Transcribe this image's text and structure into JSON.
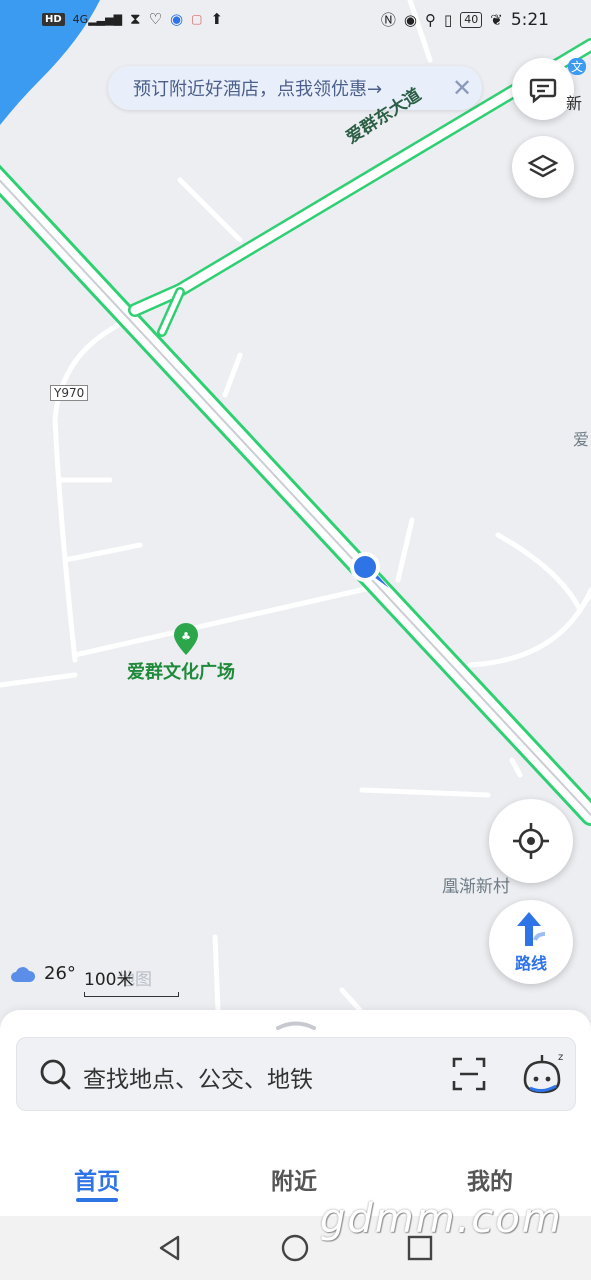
{
  "status_bar": {
    "network": "HD",
    "signal": "4G",
    "battery": "40",
    "time": "5:21"
  },
  "promo": {
    "text": "预订附近好酒店，点我领优惠→",
    "close": "✕"
  },
  "map": {
    "road_main": "爱群东大道",
    "road_badge": "Y970",
    "poi_name": "爱群文化广场",
    "village": "凰渐新村",
    "edge_label_right": "爱",
    "edge_label_top": "新",
    "edge_badge": "文",
    "watermark": "地图"
  },
  "weather": {
    "temperature": "26°",
    "scale": "100米"
  },
  "route_button": {
    "label": "路线"
  },
  "search": {
    "placeholder": "查找地点、公交、地铁"
  },
  "tabs": [
    {
      "label": "首页",
      "active": true
    },
    {
      "label": "附近",
      "active": false
    },
    {
      "label": "我的",
      "active": false
    }
  ],
  "site_watermark": "gdmm.com",
  "colors": {
    "accent": "#2f74e6",
    "road_green": "#2fcf73",
    "poi_green": "#1f8a3a",
    "water": "#3a9bf0"
  }
}
